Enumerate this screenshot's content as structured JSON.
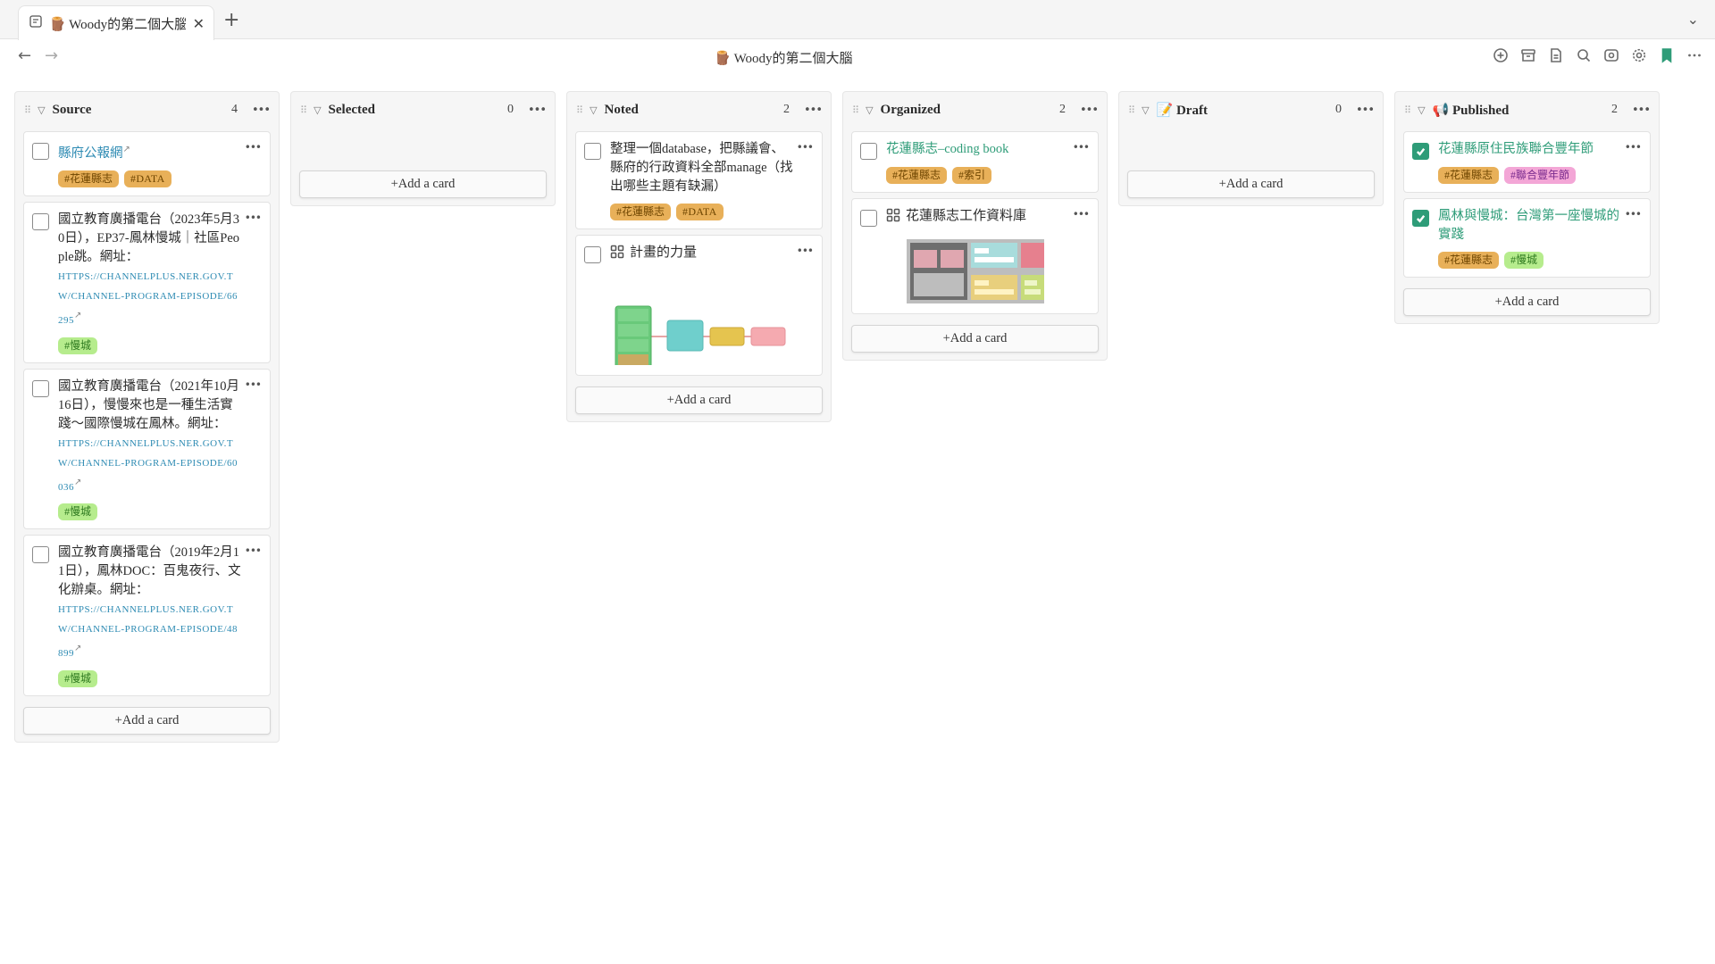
{
  "tab": {
    "title": "🪵 Woody的第二個大腦"
  },
  "page": {
    "title": "🪵 Woody的第二個大腦"
  },
  "icons": {
    "tab_page": "page-icon",
    "tab_close": "close-icon",
    "new_tab": "plus-icon",
    "tab_list": "chevron-down-icon",
    "back": "arrow-left-icon",
    "forward": "arrow-right-icon",
    "toolbar": [
      "add-circle-icon",
      "archive-icon",
      "file-icon",
      "search-icon",
      "graph-icon",
      "settings-icon",
      "bookmark-icon",
      "more-icon"
    ]
  },
  "colors": {
    "accent_green": "#2e9c78",
    "link_blue": "#2e8bb3",
    "tag_orange": "#e8b059",
    "tag_green": "#b6ec8d",
    "tag_pink": "#f3a6d6"
  },
  "board": {
    "add_label": "+Add a card",
    "columns": [
      {
        "title": "Source",
        "count": "4",
        "cards": [
          {
            "text": "縣府公報網",
            "tags": [
              "#花蓮縣志",
              "#DATA"
            ]
          },
          {
            "text": "國立教育廣播電台（2023年5月30日），EP37-鳳林慢城｜社區People跳。網址：",
            "url": "https://channelplus.ner.gov.tw/channel-program-episode/66295",
            "tags": [
              "#慢城"
            ]
          },
          {
            "text": "國立教育廣播電台（2021年10月16日），慢慢來也是一種生活實踐～國際慢城在鳳林。網址：",
            "url": "https://channelplus.ner.gov.tw/channel-program-episode/60036",
            "tags": [
              "#慢城"
            ]
          },
          {
            "text": "國立教育廣播電台（2019年2月11日），鳳林DOC：百鬼夜行、文化辦桌。網址：",
            "url": "https://channelplus.ner.gov.tw/channel-program-episode/48899",
            "tags": [
              "#慢城"
            ]
          }
        ]
      },
      {
        "title": "Selected",
        "count": "0",
        "cards": []
      },
      {
        "title": "Noted",
        "count": "2",
        "cards": [
          {
            "text": "整理一個database，把縣議會、縣府的行政資料全部manage（找出哪些主題有缺漏）",
            "tags": [
              "#花蓮縣志",
              "#DATA"
            ]
          },
          {
            "text": "計畫的力量"
          }
        ]
      },
      {
        "title": "Organized",
        "count": "2",
        "cards": [
          {
            "text": "花蓮縣志–coding book",
            "tags": [
              "#花蓮縣志",
              "#索引"
            ]
          },
          {
            "text": "花蓮縣志工作資料庫"
          }
        ]
      },
      {
        "title": "📝 Draft",
        "count": "0",
        "cards": []
      },
      {
        "title": "📢 Published",
        "count": "2",
        "cards": [
          {
            "text": "花蓮縣原住民族聯合豐年節",
            "tags": [
              "#花蓮縣志",
              "#聯合豐年節"
            ]
          },
          {
            "text": "鳳林與慢城：台灣第一座慢城的實踐",
            "tags": [
              "#花蓮縣志",
              "#慢城"
            ]
          }
        ]
      }
    ]
  }
}
